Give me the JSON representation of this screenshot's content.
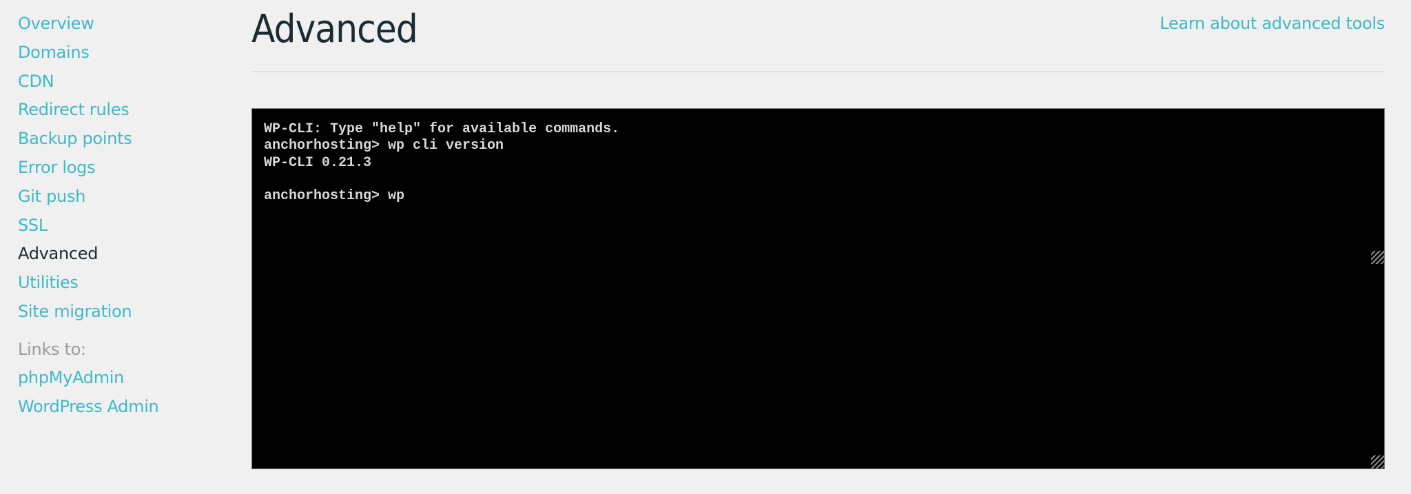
{
  "sidebar": {
    "items": [
      {
        "label": "Overview",
        "active": false
      },
      {
        "label": "Domains",
        "active": false
      },
      {
        "label": "CDN",
        "active": false
      },
      {
        "label": "Redirect rules",
        "active": false
      },
      {
        "label": "Backup points",
        "active": false
      },
      {
        "label": "Error logs",
        "active": false
      },
      {
        "label": "Git push",
        "active": false
      },
      {
        "label": "SSL",
        "active": false
      },
      {
        "label": "Advanced",
        "active": true
      },
      {
        "label": "Utilities",
        "active": false
      },
      {
        "label": "Site migration",
        "active": false
      }
    ],
    "links_label": "Links to:",
    "links": [
      {
        "label": "phpMyAdmin"
      },
      {
        "label": "WordPress Admin"
      }
    ]
  },
  "header": {
    "title": "Advanced",
    "learn_link": "Learn about advanced tools"
  },
  "terminal": {
    "lines": [
      "WP-CLI: Type \"help\" for available commands.",
      "anchorhosting> wp cli version",
      "WP-CLI 0.21.3",
      ""
    ],
    "prompt": "anchorhosting> ",
    "input_value": "wp"
  },
  "colors": {
    "accent": "#3fb8c9",
    "active_text": "#1c2b33",
    "muted": "#9a9a9a",
    "background": "#f0f0f0",
    "terminal_bg": "#000000",
    "terminal_text": "#d8d8d8"
  }
}
